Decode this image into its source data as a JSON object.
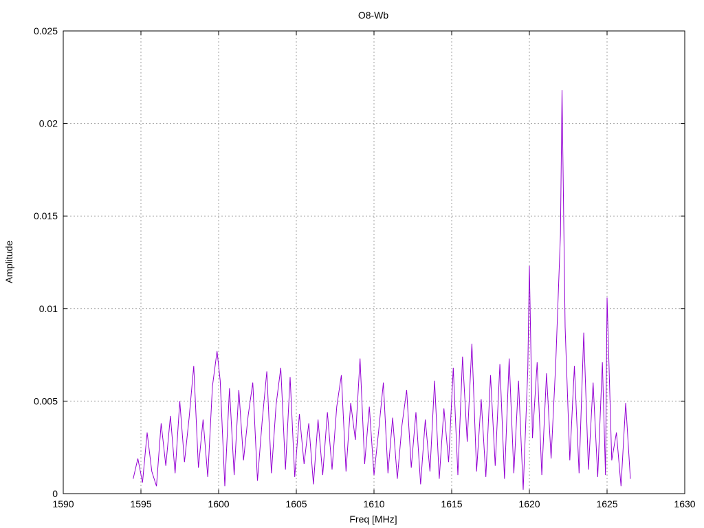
{
  "chart_data": {
    "type": "line",
    "title": "O8-Wb",
    "xlabel": "Freq [MHz]",
    "ylabel": "Amplitude",
    "xlim": [
      1590,
      1630
    ],
    "ylim": [
      0,
      0.025
    ],
    "xticks": [
      1590,
      1595,
      1600,
      1605,
      1610,
      1615,
      1620,
      1625,
      1630
    ],
    "xtick_labels": [
      "1590",
      "1595",
      "1600",
      "1605",
      "1610",
      "1615",
      "1620",
      "1625",
      "1630"
    ],
    "yticks": [
      0,
      0.005,
      0.01,
      0.015,
      0.02,
      0.025
    ],
    "ytick_labels": [
      "0",
      "0.005",
      "0.01",
      "0.015",
      "0.02",
      "0.025"
    ],
    "grid": true,
    "legend": "none",
    "series": [
      {
        "color": "#9400d3",
        "x": [
          1594.5,
          1594.8,
          1595.1,
          1595.4,
          1595.7,
          1596.0,
          1596.3,
          1596.6,
          1596.9,
          1597.2,
          1597.5,
          1597.8,
          1598.1,
          1598.4,
          1598.7,
          1599.0,
          1599.3,
          1599.6,
          1599.9,
          1600.1,
          1600.4,
          1600.7,
          1601.0,
          1601.3,
          1601.6,
          1601.9,
          1602.2,
          1602.5,
          1602.8,
          1603.1,
          1603.4,
          1603.7,
          1604.0,
          1604.3,
          1604.6,
          1604.9,
          1605.2,
          1605.5,
          1605.8,
          1606.1,
          1606.4,
          1606.7,
          1607.0,
          1607.3,
          1607.6,
          1607.9,
          1608.2,
          1608.5,
          1608.8,
          1609.1,
          1609.4,
          1609.7,
          1610.0,
          1610.3,
          1610.6,
          1610.9,
          1611.2,
          1611.5,
          1611.8,
          1612.1,
          1612.4,
          1612.7,
          1613.0,
          1613.3,
          1613.6,
          1613.9,
          1614.2,
          1614.5,
          1614.8,
          1615.1,
          1615.4,
          1615.7,
          1616.0,
          1616.3,
          1616.6,
          1616.9,
          1617.2,
          1617.5,
          1617.8,
          1618.1,
          1618.4,
          1618.7,
          1619.0,
          1619.3,
          1619.6,
          1619.9,
          1620.0,
          1620.2,
          1620.5,
          1620.8,
          1621.1,
          1621.4,
          1621.7,
          1622.0,
          1622.1,
          1622.3,
          1622.6,
          1622.9,
          1623.2,
          1623.5,
          1623.8,
          1624.1,
          1624.4,
          1624.7,
          1624.9,
          1625.0,
          1625.3,
          1625.6,
          1625.9,
          1626.2,
          1626.5
        ],
        "y": [
          0.0008,
          0.0019,
          0.0006,
          0.0033,
          0.0012,
          0.0004,
          0.0038,
          0.0015,
          0.0042,
          0.0011,
          0.005,
          0.0017,
          0.0041,
          0.0069,
          0.0014,
          0.004,
          0.0009,
          0.0058,
          0.0077,
          0.0061,
          0.0004,
          0.0057,
          0.001,
          0.0056,
          0.0018,
          0.0042,
          0.006,
          0.0007,
          0.0039,
          0.0066,
          0.0011,
          0.0048,
          0.0068,
          0.0013,
          0.0063,
          0.0009,
          0.0043,
          0.0016,
          0.0038,
          0.0005,
          0.004,
          0.001,
          0.0044,
          0.0013,
          0.0047,
          0.0064,
          0.0012,
          0.0049,
          0.0029,
          0.0073,
          0.0016,
          0.0047,
          0.001,
          0.0034,
          0.006,
          0.0011,
          0.0041,
          0.0008,
          0.0037,
          0.0056,
          0.0014,
          0.0044,
          0.0005,
          0.004,
          0.0012,
          0.0061,
          0.0008,
          0.0046,
          0.0017,
          0.0068,
          0.001,
          0.0074,
          0.0028,
          0.0081,
          0.0012,
          0.0051,
          0.0009,
          0.0064,
          0.0015,
          0.007,
          0.0008,
          0.0073,
          0.0011,
          0.0061,
          0.0002,
          0.0067,
          0.0123,
          0.003,
          0.0071,
          0.001,
          0.0065,
          0.0019,
          0.0071,
          0.014,
          0.0218,
          0.009,
          0.0018,
          0.0069,
          0.0011,
          0.0087,
          0.0013,
          0.006,
          0.0009,
          0.0071,
          0.001,
          0.0106,
          0.0018,
          0.0033,
          0.0004,
          0.0049,
          0.0008
        ]
      }
    ]
  }
}
